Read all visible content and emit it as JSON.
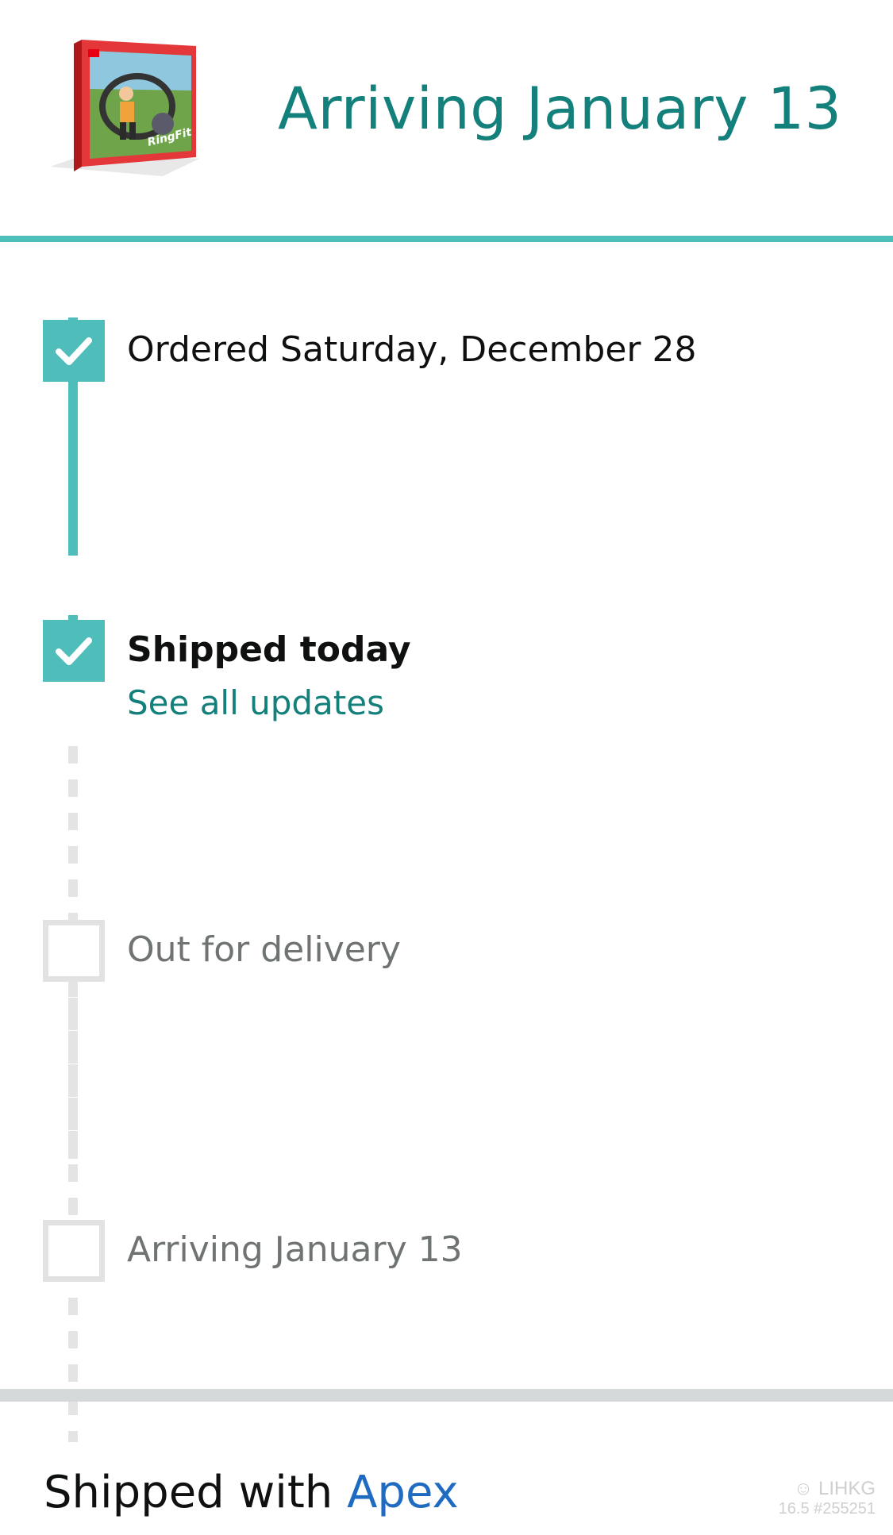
{
  "header": {
    "title": "Arriving January 13",
    "product_image_icon": "ring-fit-adventure-box"
  },
  "timeline": {
    "steps": [
      {
        "label": "Ordered Saturday, December 28",
        "status": "done"
      },
      {
        "label": "Shipped today",
        "status": "done",
        "link": "See all updates"
      },
      {
        "label": "Out for delivery",
        "status": "pending"
      },
      {
        "label": "Arriving January 13",
        "status": "pending"
      }
    ]
  },
  "shipping": {
    "prefix": "Shipped with",
    "carrier": "Apex"
  },
  "watermark": {
    "brand": "LIHKG",
    "id": "16.5 #255251"
  },
  "colors": {
    "accent": "#13807b",
    "progress": "#4fbdba",
    "link": "#1f6bc1",
    "pending": "#e2e2e2"
  }
}
